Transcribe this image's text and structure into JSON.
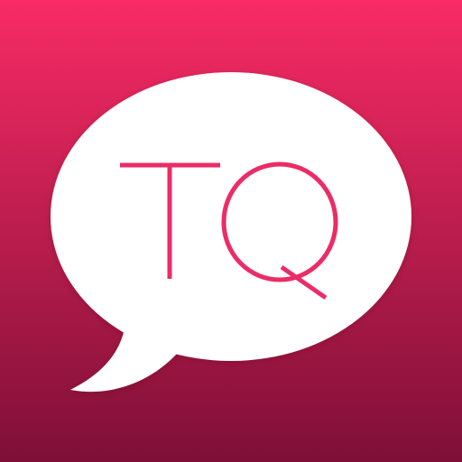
{
  "app_icon": {
    "monogram_text": "TQ",
    "colors": {
      "background_top": "#F82B65",
      "background_bottom": "#7E0F37",
      "bubble_fill": "#FFFFFF",
      "letter_color": "#EB2C66"
    },
    "icon_name": "speech-bubble-icon"
  }
}
